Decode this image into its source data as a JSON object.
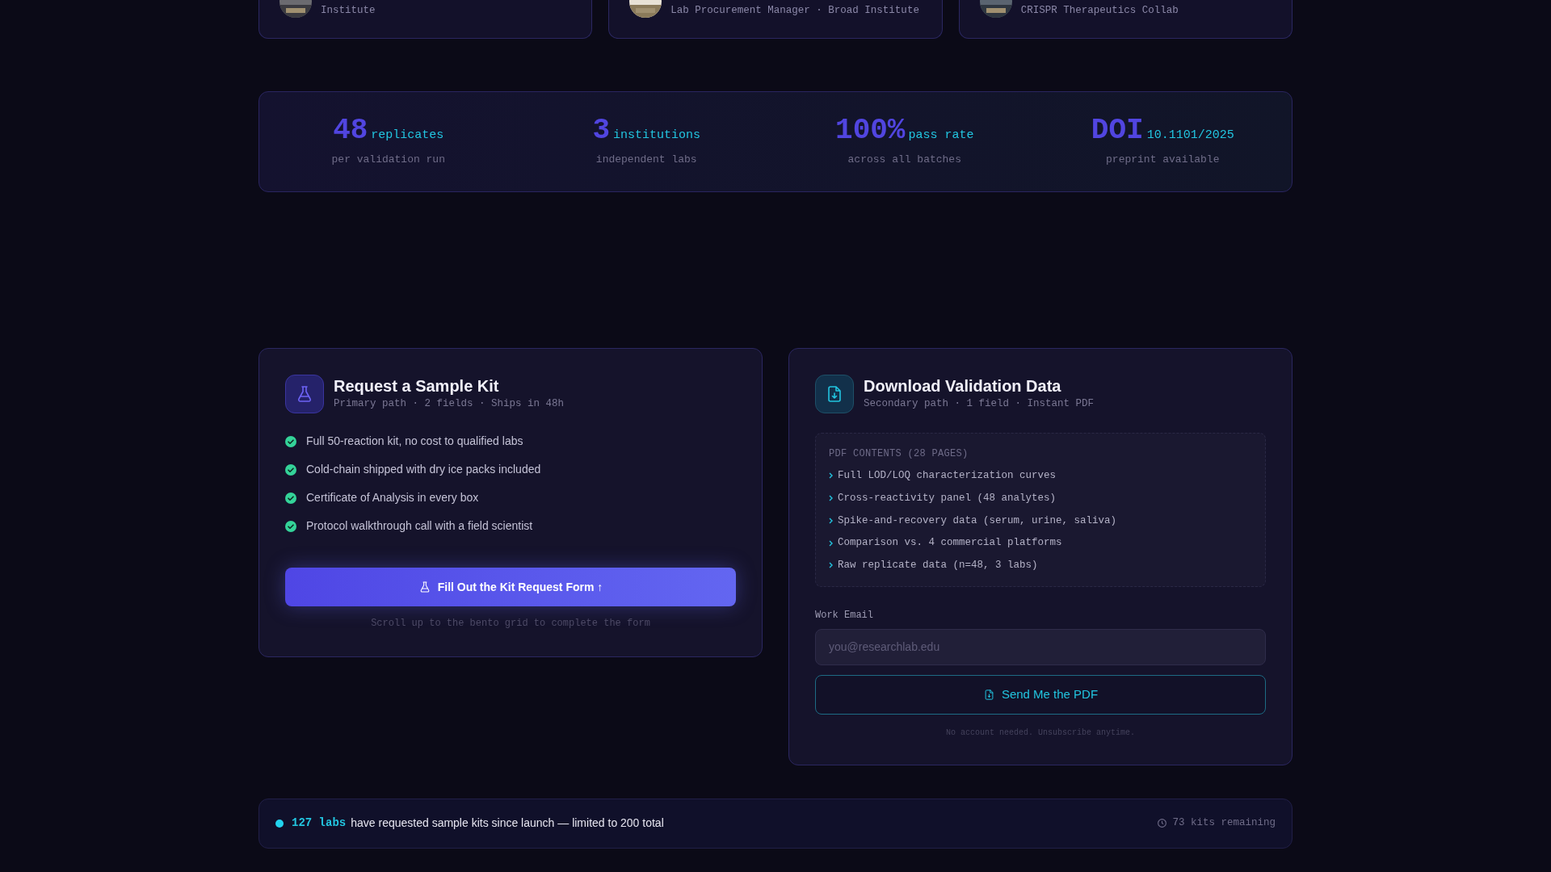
{
  "testimonials": [
    {
      "role": "Institute"
    },
    {
      "role": "Lab Procurement Manager · Broad Institute"
    },
    {
      "role": "CRISPR Therapeutics Collab"
    }
  ],
  "stats": [
    {
      "value": "48",
      "unit": "replicates",
      "caption": "per validation run"
    },
    {
      "value": "3",
      "unit": "institutions",
      "caption": "independent labs"
    },
    {
      "value": "100%",
      "unit": "pass rate",
      "caption": "across all batches"
    },
    {
      "value": "DOI",
      "unit": "10.1101/2025",
      "caption": "preprint available"
    }
  ],
  "kit_card": {
    "title": "Request a Sample Kit",
    "subtitle": "Primary path · 2 fields · Ships in 48h",
    "benefits": [
      "Full 50-reaction kit, no cost to qualified labs",
      "Cold-chain shipped with dry ice packs included",
      "Certificate of Analysis in every box",
      "Protocol walkthrough call with a field scientist"
    ],
    "button": "Fill Out the Kit Request Form ↑",
    "note": "Scroll up to the bento grid to complete the form"
  },
  "data_card": {
    "title": "Download Validation Data",
    "subtitle": "Secondary path · 1 field · Instant PDF",
    "contents_heading": "PDF CONTENTS (28 PAGES)",
    "contents": [
      "Full LOD/LOQ characterization curves",
      "Cross-reactivity panel (48 analytes)",
      "Spike-and-recovery data (serum, urine, saliva)",
      "Comparison vs. 4 commercial platforms",
      "Raw replicate data (n=48, 3 labs)"
    ],
    "email_label": "Work Email",
    "email_placeholder": "you@researchlab.edu",
    "button": "Send Me the PDF",
    "note": "No account needed. Unsubscribe anytime."
  },
  "status_bar": {
    "highlight": "127 labs",
    "text": "have requested sample kits since launch — limited to 200 total",
    "remaining": "73 kits remaining"
  }
}
